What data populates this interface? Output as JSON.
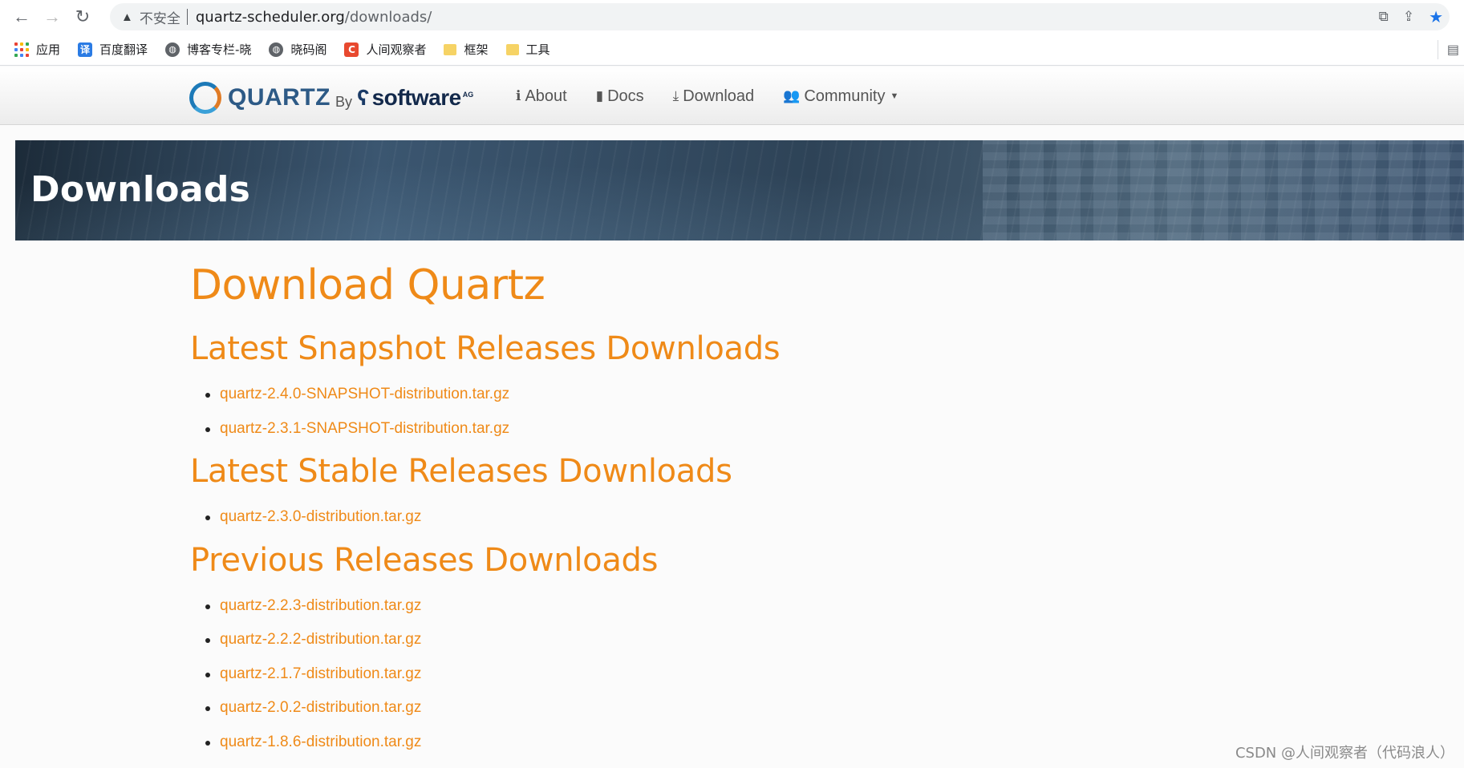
{
  "browser": {
    "security_label": "不安全",
    "url_host": "quartz-scheduler.org",
    "url_path": "/downloads/",
    "bookmarks": [
      {
        "label": "应用",
        "icon": "apps-grid-icon"
      },
      {
        "label": "百度翻译",
        "icon": "translate-icon",
        "glyph": "译"
      },
      {
        "label": "博客专栏-晓",
        "icon": "globe-icon",
        "glyph": "◍"
      },
      {
        "label": "晓码阁",
        "icon": "globe-icon",
        "glyph": "◍"
      },
      {
        "label": "人间观察者",
        "icon": "csdn-c-icon",
        "glyph": "C"
      },
      {
        "label": "框架",
        "icon": "folder-icon",
        "glyph": ""
      },
      {
        "label": "工具",
        "icon": "folder-icon",
        "glyph": ""
      }
    ]
  },
  "navbar": {
    "brand_quartz": "QUARTZ",
    "brand_by": "By",
    "brand_software": "software",
    "brand_ag": "AG",
    "links": [
      {
        "label": "About",
        "icon": "info-icon",
        "glyph": "ℹ"
      },
      {
        "label": "Docs",
        "icon": "book-icon",
        "glyph": "▮"
      },
      {
        "label": "Download",
        "icon": "download-icon",
        "glyph": "⤓"
      },
      {
        "label": "Community",
        "icon": "users-icon",
        "glyph": "👥"
      }
    ]
  },
  "banner": {
    "title": "Downloads"
  },
  "main": {
    "title": "Download Quartz",
    "sections": [
      {
        "heading": "Latest Snapshot Releases Downloads",
        "links": [
          "quartz-2.4.0-SNAPSHOT-distribution.tar.gz",
          "quartz-2.3.1-SNAPSHOT-distribution.tar.gz"
        ]
      },
      {
        "heading": "Latest Stable Releases Downloads",
        "links": [
          "quartz-2.3.0-distribution.tar.gz"
        ]
      },
      {
        "heading": "Previous Releases Downloads",
        "links": [
          "quartz-2.2.3-distribution.tar.gz",
          "quartz-2.2.2-distribution.tar.gz",
          "quartz-2.1.7-distribution.tar.gz",
          "quartz-2.0.2-distribution.tar.gz",
          "quartz-1.8.6-distribution.tar.gz"
        ]
      }
    ]
  },
  "watermark": "CSDN @人间观察者（代码浪人）",
  "colors": {
    "accent_orange": "#ef8a18",
    "chrome_blue": "#1a73e8"
  }
}
